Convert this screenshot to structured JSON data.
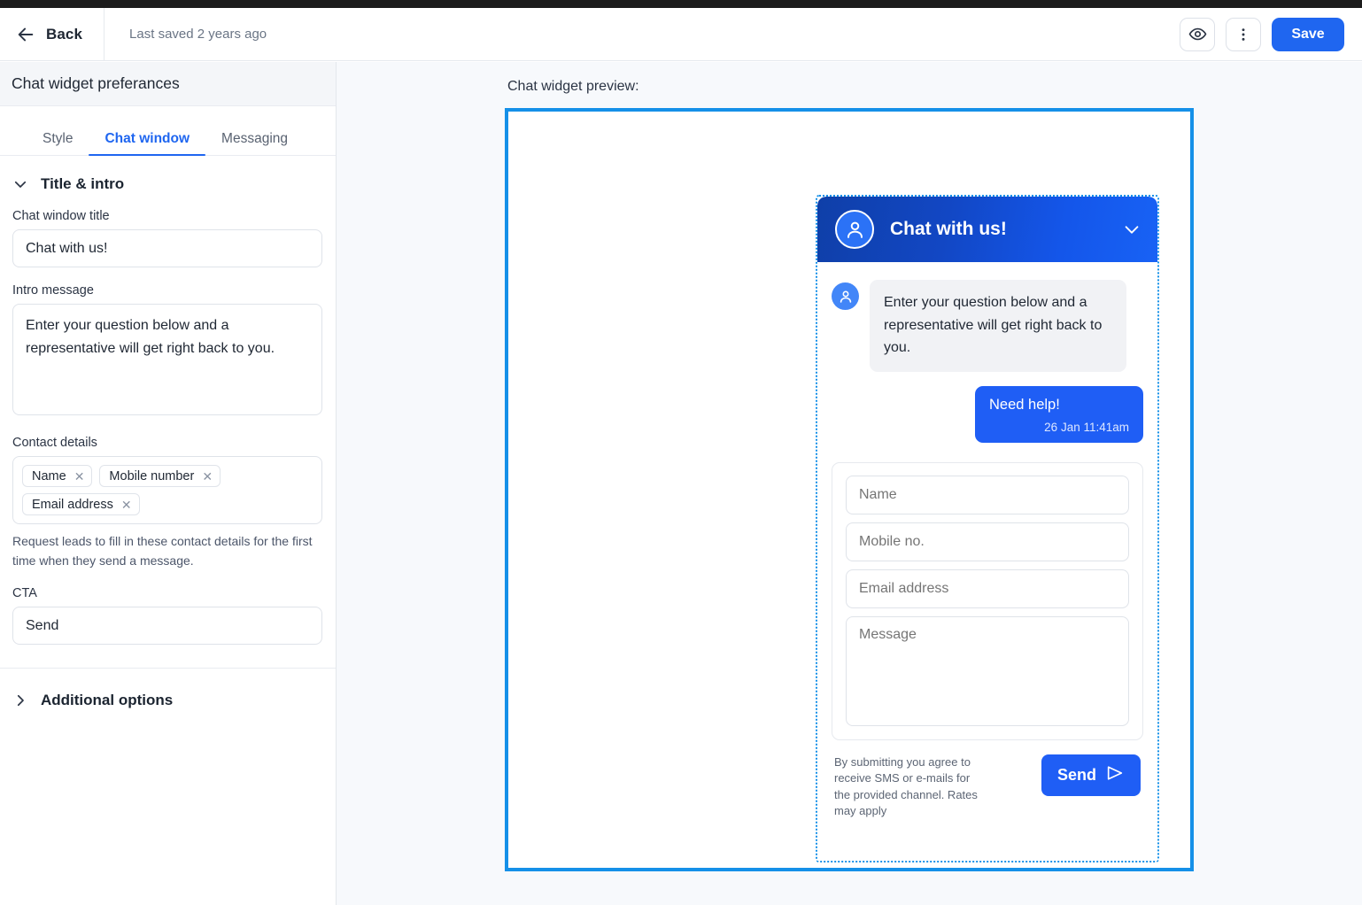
{
  "topbar": {
    "back_label": "Back",
    "saved_text": "Last saved 2 years ago",
    "preview_icon": "eye-icon",
    "more_icon": "kebab-menu-icon",
    "save_label": "Save",
    "accent_color": "#1f66f0"
  },
  "sidebar": {
    "title": "Chat widget preferances",
    "tabs": [
      {
        "label": "Style",
        "active": false
      },
      {
        "label": "Chat window",
        "active": true
      },
      {
        "label": "Messaging",
        "active": false
      }
    ],
    "sections": [
      {
        "label": "Title & intro",
        "expanded": true,
        "icon": "chevron-down-icon"
      },
      {
        "label": "Additional options",
        "expanded": false,
        "icon": "chevron-right-icon"
      }
    ],
    "fields": {
      "chat_window_title": {
        "label": "Chat window title",
        "value": "Chat with us!",
        "placeholder": "Chat window title"
      },
      "intro_message": {
        "label": "Intro message",
        "value": "Enter your question below and a representative will get right back to you.",
        "placeholder": "Intro message"
      },
      "contact_details": {
        "label": "Contact details",
        "chips": [
          "Name",
          "Mobile number",
          "Email address"
        ],
        "remove_icon": "close-icon",
        "hint": "Request leads to fill in these contact details for the first time when they send a message."
      },
      "cta": {
        "label": "CTA",
        "value": "Send",
        "placeholder": "CTA"
      }
    }
  },
  "preview": {
    "label": "Chat widget preview:",
    "frame_border_color": "#1590e8",
    "outline_color": "#1590e8",
    "widget": {
      "header": {
        "title": "Chat with us!",
        "avatar_icon": "user-avatar-icon",
        "collapse_icon": "chevron-down-icon",
        "gradient_from": "#0f3fa8",
        "gradient_to": "#1862f5"
      },
      "messages": [
        {
          "direction": "incoming",
          "avatar_icon": "user-avatar-icon",
          "text": "Enter your question below and a representative will get right back to you."
        },
        {
          "direction": "outgoing",
          "text": "Need help!",
          "time": "26 Jan 11:41am",
          "bubble_color": "#1f5ef5"
        }
      ],
      "form": {
        "name_placeholder": "Name",
        "mobile_placeholder": "Mobile no.",
        "email_placeholder": "Email address",
        "message_placeholder": "Message"
      },
      "disclaimer": "By submitting you agree to receive SMS or e-mails for the provided channel. Rates may apply",
      "send_label": "Send",
      "send_icon": "paper-plane-icon"
    }
  }
}
